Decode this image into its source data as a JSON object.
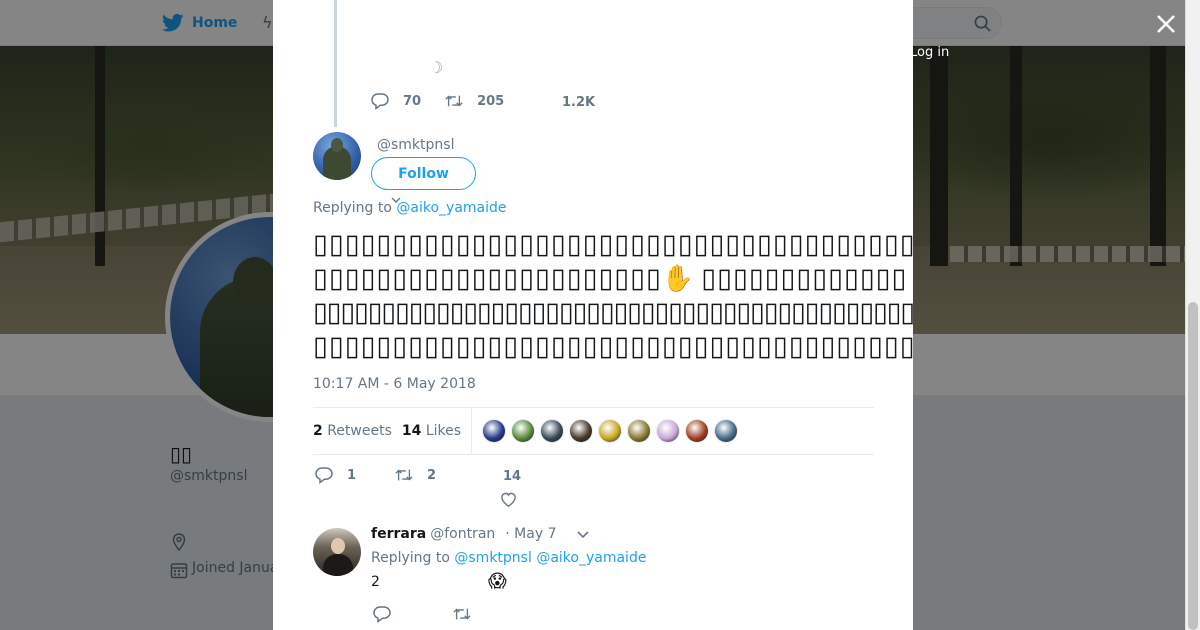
{
  "nav": {
    "home_label": "Home",
    "login_label": "Log in"
  },
  "profile": {
    "name": "▯▯",
    "handle": "@smktpnsl",
    "joined": "Joined Janua"
  },
  "previous_tweet": {
    "reply_count": "70",
    "retweet_count": "205",
    "like_count": "1.2K"
  },
  "tweet": {
    "handle": "@smktpnsl",
    "follow_label": "Follow",
    "replying_prefix": "Replying to",
    "replying_to": "@aiko_yamaide",
    "text_lines": [
      {
        "text": "▯▯▯▯▯▯▯▯▯▯▯▯▯▯▯▯▯▯▯▯▯▯▯▯▯▯▯▯▯▯▯▯▯▯▯▯▯▯▯▯▯▯▯▯▯",
        "emoji": "👀"
      },
      {
        "text": "▯▯▯▯▯▯▯▯▯▯▯▯▯▯▯▯▯▯▯▯▯▯",
        "emoji": "✋",
        "text2": "▯▯▯▯▯▯▯▯▯▯▯▯▯",
        "emoji2": "✋"
      },
      {
        "text": "▯▯▯▯▯▯▯▯▯▯▯▯▯▯▯▯▯▯▯▯▯▯▯▯▯▯▯▯▯▯▯▯▯▯▯▯▯▯▯▯▯▯▯▯▯▯▯▯▯▯▯▯▯▯▯▯",
        "emoji": "🍵"
      },
      {
        "text": "▯▯▯▯▯▯▯▯▯▯▯▯▯▯▯▯▯▯▯▯▯▯▯▯▯▯▯▯▯▯▯▯▯▯▯▯▯▯▯▯▯▯▯",
        "emoji": "😑"
      }
    ],
    "timestamp": "10:17 AM - 6 May 2018",
    "retweets_num": "2",
    "retweets_label": "Retweets",
    "likes_num": "14",
    "likes_label": "Likes",
    "reply_count": "1",
    "retweet_count": "2",
    "like_count": "14",
    "liker_colors": [
      "#2a3a8c",
      "#5a8a3a",
      "#3a4a5a",
      "#4a3a2a",
      "#c8a820",
      "#8a7a30",
      "#c8a8d8",
      "#a04020",
      "#4a6a8a"
    ]
  },
  "reply": {
    "name": "ferrara",
    "handle": "@fontran",
    "date": "· May 7",
    "replying_prefix": "Replying to",
    "replying_to_1": "@smktpnsl",
    "replying_to_2": "@aiko_yamaide",
    "text": "2",
    "emoji": "😱"
  },
  "colors": {
    "accent": "#1da1f2",
    "muted": "#657786",
    "text": "#14171a"
  },
  "icons": [
    "twitter-bird-icon",
    "search-icon",
    "close-icon",
    "reply-icon",
    "retweet-icon",
    "heart-icon",
    "chevron-down-icon",
    "location-icon",
    "calendar-icon"
  ]
}
